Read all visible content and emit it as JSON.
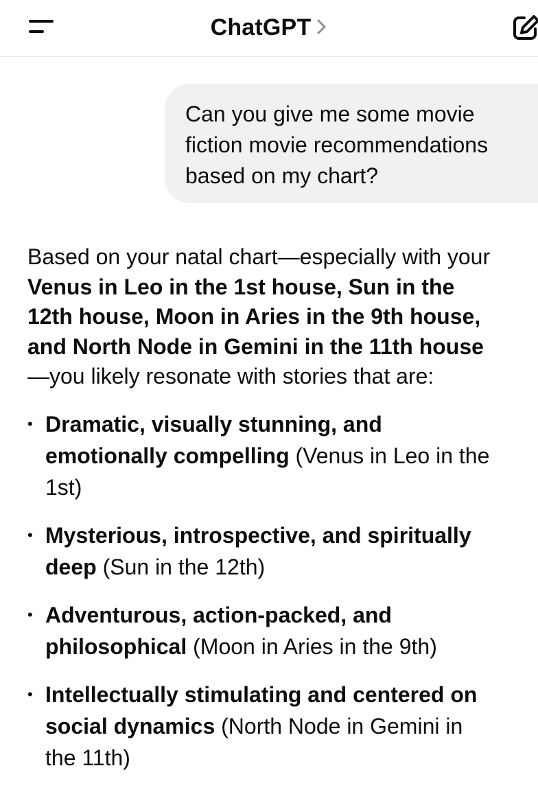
{
  "header": {
    "title": "ChatGPT",
    "chevron": ">",
    "menu_icon": "menu-icon",
    "new_chat_icon": "compose-icon"
  },
  "user_message": {
    "lines": [
      "Can you give me some movie",
      "fiction movie recommendations",
      "based on my chart?"
    ]
  },
  "assistant_message": {
    "intro_line1": "Based on your natal chart—especially with your",
    "intro_bold_line1": "Venus in Leo in the 1st house, Sun in the",
    "intro_bold_line2": "12th house, Moon in Aries in the 9th house,",
    "intro_bold_line3": "and North Node in Gemini in the 11th house",
    "intro_tail": "—you likely resonate with stories that are:",
    "bullets": [
      {
        "bold_line1": "Dramatic, visually stunning, and",
        "bold_line2": "emotionally compelling",
        "rest_line2": " (Venus in Leo in the",
        "rest_line3": "1st)"
      },
      {
        "bold_line1": "Mysterious, introspective, and spiritually",
        "bold_line2": "deep",
        "rest_line2": " (Sun in the 12th)"
      },
      {
        "bold_line1": "Adventurous, action-packed, and",
        "bold_line2": "philosophical",
        "rest_line2": " (Moon in Aries in the 9th)"
      },
      {
        "bold_line1": "Intellectually stimulating and centered on",
        "bold_line2": "social dynamics",
        "rest_line2": " (North Node in Gemini in",
        "rest_line3": "the 11th)"
      }
    ]
  }
}
